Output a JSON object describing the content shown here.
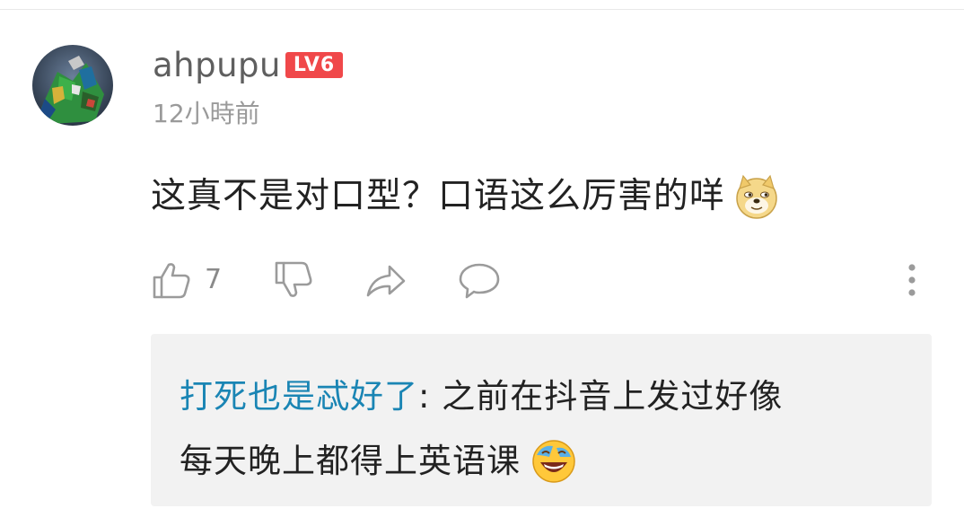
{
  "comment": {
    "username": "ahpupu",
    "level_badge": "LV6",
    "timestamp": "12小時前",
    "text": "这真不是对口型？口语这么厉害的咩",
    "emoji": "doge-emoji",
    "avatar_icon": "robot-avatar-icon"
  },
  "actions": {
    "like_icon": "thumbs-up-icon",
    "like_count": "7",
    "dislike_icon": "thumbs-down-icon",
    "share_icon": "share-arrow-icon",
    "reply_icon": "speech-bubble-icon",
    "more_icon": "more-vertical-icon"
  },
  "reply": {
    "author": "打死也是忒好了",
    "separator": ": ",
    "line1_text": "之前在抖音上发过好像",
    "line2_text": "每天晚上都得上英语课",
    "emoji": "laughing-tears-emoji"
  },
  "colors": {
    "level_badge": "#f0484a",
    "reply_author": "#1a85b4",
    "reply_background": "#f2f2f2",
    "secondary_text": "#9a9a9a",
    "icon_gray": "#9b9b9b"
  }
}
